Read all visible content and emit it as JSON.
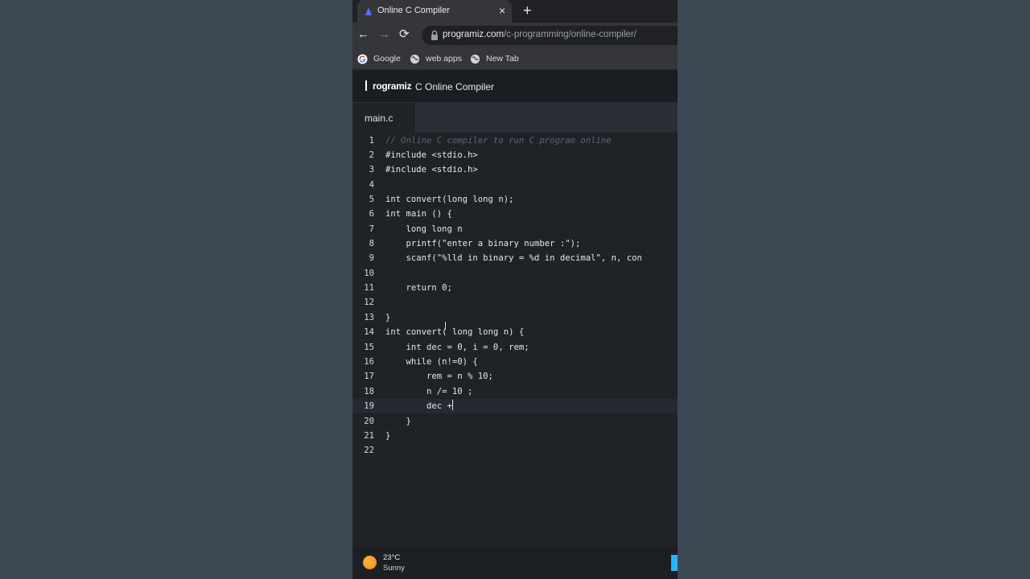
{
  "browser": {
    "tab_title": "Online C Compiler",
    "tab_close": "×",
    "new_tab": "+",
    "url_host": "programiz.com",
    "url_path": "/c-programming/online-compiler/",
    "nav": {
      "back": "←",
      "forward": "→",
      "reload": "⟳"
    },
    "bookmarks": [
      {
        "label": "Google",
        "icon": "google-icon"
      },
      {
        "label": "web apps",
        "icon": "globe-icon"
      },
      {
        "label": "New Tab",
        "icon": "globe-icon"
      }
    ]
  },
  "site": {
    "logo": "rogramiz",
    "title": "C Online Compiler"
  },
  "editor": {
    "file_tab": "main.c",
    "line_numbers": [
      "1",
      "2",
      "3",
      "4",
      "5",
      "6",
      "7",
      "8",
      "9",
      "10",
      "11",
      "12",
      "13",
      "14",
      "15",
      "16",
      "17",
      "18",
      "19",
      "20",
      "21",
      "22"
    ],
    "lines": [
      "// Online C compiler to run C program online",
      "#include <stdio.h>",
      "#include <stdio.h>",
      "",
      "int convert(long long n);",
      "int main () {",
      "    long long n",
      "    printf(\"enter a binary number :\");",
      "    scanf(\"%lld in binary = %d in decimal\", n, con",
      "",
      "    return 0;",
      "",
      "}",
      "int convert( long long n) {",
      "    int dec = 0, i = 0, rem;",
      "    while (n!=0) {",
      "        rem = n % 10;",
      "        n /= 10 ;",
      "        dec +",
      "    }",
      "}",
      ""
    ]
  },
  "taskbar": {
    "temperature": "23°C",
    "condition": "Sunny"
  },
  "colors": {
    "background": "#3c4955",
    "editor_bg": "#1f2328",
    "comment": "#5b6470",
    "header_string": "#d0736a",
    "number": "#d88c6a"
  }
}
